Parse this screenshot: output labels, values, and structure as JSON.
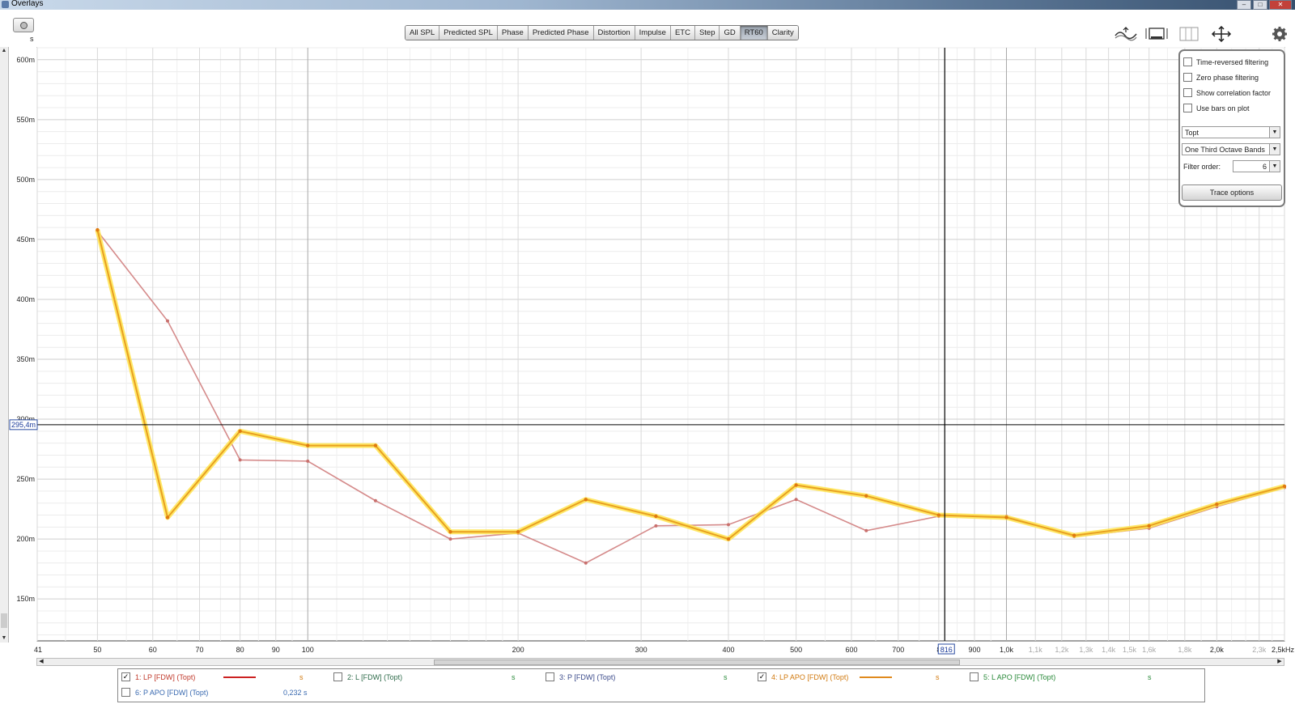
{
  "window": {
    "title": "Overlays"
  },
  "toolbar": {
    "units_label": "s",
    "tabs": [
      "All SPL",
      "Predicted SPL",
      "Phase",
      "Predicted Phase",
      "Distortion",
      "Impulse",
      "ETC",
      "Step",
      "GD",
      "RT60",
      "Clarity"
    ],
    "active_tab": "RT60"
  },
  "side_panel": {
    "options": [
      "Time-reversed filtering",
      "Zero phase filtering",
      "Show correlation factor",
      "Use bars on plot"
    ],
    "rt_metric": "Topt",
    "bands": "One Third Octave Bands",
    "filter_order_label": "Filter order:",
    "filter_order": "6",
    "trace_options": "Trace options"
  },
  "cursor": {
    "y_readout": "295,4m",
    "x_readout": "816"
  },
  "legend": [
    {
      "label": "1: LP [FDW] (Topt)",
      "checked": true,
      "color": "#cc2222",
      "text_color": "#c0392b",
      "unit": "s",
      "value": ""
    },
    {
      "label": "2: L [FDW] (Topt)",
      "checked": false,
      "color": "",
      "text_color": "#2e6b4a",
      "unit": "s",
      "value": ""
    },
    {
      "label": "3: P [FDW] (Topt)",
      "checked": false,
      "color": "",
      "text_color": "#3a4a8a",
      "unit": "s",
      "value": ""
    },
    {
      "label": "4: LP APO [FDW] (Topt)",
      "checked": true,
      "color": "#e08a1e",
      "text_color": "#d17a10",
      "unit": "s",
      "value": ""
    },
    {
      "label": "5: L APO [FDW] (Topt)",
      "checked": false,
      "color": "",
      "text_color": "#2a8a3a",
      "unit": "s",
      "value": ""
    },
    {
      "label": "6: P APO [FDW] (Topt)",
      "checked": false,
      "color": "",
      "text_color": "#3a6ab0",
      "unit": "",
      "value": "0,232 s"
    }
  ],
  "chart_data": {
    "type": "line",
    "xscale": "log",
    "xlim": [
      41,
      2500
    ],
    "ylim": [
      115,
      610
    ],
    "yunit": "s",
    "y_ticks": [
      150,
      200,
      250,
      300,
      350,
      400,
      450,
      500,
      550,
      600
    ],
    "y_tick_labels": [
      "150m",
      "200m",
      "250m",
      "300m",
      "350m",
      "400m",
      "450m",
      "500m",
      "550m",
      "600m"
    ],
    "x_ticks": [
      41,
      50,
      60,
      70,
      80,
      90,
      100,
      200,
      300,
      400,
      500,
      600,
      700,
      800,
      900,
      1000,
      1100,
      1200,
      1300,
      1400,
      1500,
      1600,
      1800,
      2000,
      2300,
      2500
    ],
    "x_tick_labels": [
      "41",
      "50",
      "60",
      "70",
      "80",
      "90",
      "100",
      "200",
      "300",
      "400",
      "500",
      "600",
      "700",
      "8",
      "900",
      "1,0k",
      "1,1k",
      "1,2k",
      "1,3k",
      "1,4k",
      "1,5k",
      "1,6k",
      "1,8k",
      "2,0k",
      "2,3k",
      "2,5kHz"
    ],
    "x_tick_dim": [
      false,
      false,
      false,
      false,
      false,
      false,
      false,
      false,
      false,
      false,
      false,
      false,
      false,
      false,
      false,
      false,
      true,
      true,
      true,
      true,
      true,
      true,
      true,
      false,
      true,
      false
    ],
    "cursor": {
      "x": 816,
      "y": 295.4
    },
    "series": [
      {
        "name": "1: LP [FDW] (Topt)",
        "color": "#d58b8b",
        "x": [
          50,
          63,
          80,
          100,
          125,
          160,
          200,
          250,
          315,
          400,
          500,
          630,
          800,
          1000,
          1250,
          1600,
          2000,
          2500
        ],
        "y": [
          457,
          382,
          266,
          265,
          232,
          200,
          205,
          180,
          211,
          212,
          233,
          207,
          219,
          219,
          202,
          209,
          227,
          243
        ]
      },
      {
        "name": "4: LP APO [FDW] (Topt)",
        "color": "#e8a020",
        "x": [
          50,
          63,
          80,
          100,
          125,
          160,
          200,
          250,
          315,
          400,
          500,
          630,
          800,
          1000,
          1250,
          1600,
          2000,
          2500
        ],
        "y": [
          458,
          218,
          290,
          278,
          278,
          206,
          206,
          233,
          219,
          200,
          245,
          236,
          220,
          218,
          203,
          211,
          229,
          244
        ]
      }
    ]
  }
}
